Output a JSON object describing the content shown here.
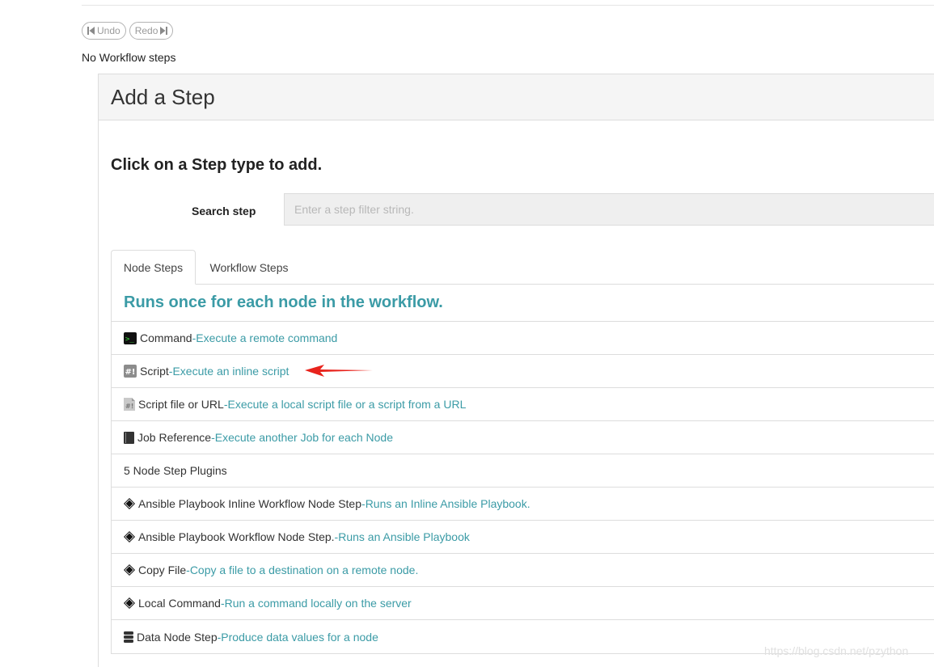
{
  "history": {
    "undo_label": "Undo",
    "redo_label": "Redo"
  },
  "workflow": {
    "empty_message": "No Workflow steps"
  },
  "panel": {
    "title": "Add a Step",
    "instruction": "Click on a Step type to add.",
    "search": {
      "label": "Search step",
      "placeholder": "Enter a step filter string.",
      "value": ""
    },
    "tabs": [
      {
        "label": "Node Steps",
        "active": true
      },
      {
        "label": "Workflow Steps",
        "active": false
      }
    ],
    "list_heading": "Runs once for each node in the workflow.",
    "steps": [
      {
        "icon": "terminal-icon",
        "name": "Command",
        "separator": " - ",
        "description": "Execute a remote command"
      },
      {
        "icon": "script-icon",
        "name": "Script",
        "separator": " - ",
        "description": "Execute an inline script"
      },
      {
        "icon": "script-file-icon",
        "name": "Script file or URL",
        "separator": " - ",
        "description": "Execute a local script file or a script from a URL"
      },
      {
        "icon": "book-icon",
        "name": "Job Reference",
        "separator": " - ",
        "description": "Execute another Job for each Node"
      }
    ],
    "plugins_heading": "5 Node Step Plugins",
    "plugins": [
      {
        "icon": "plugin-diamond-icon",
        "name": "Ansible Playbook Inline Workflow Node Step",
        "separator": " - ",
        "description": "Runs an Inline Ansible Playbook."
      },
      {
        "icon": "plugin-diamond-icon",
        "name": "Ansible Playbook Workflow Node Step.",
        "separator": " - ",
        "description": "Runs an Ansible Playbook"
      },
      {
        "icon": "plugin-diamond-icon",
        "name": "Copy File",
        "separator": " - ",
        "description": "Copy a file to a destination on a remote node."
      },
      {
        "icon": "plugin-diamond-icon",
        "name": "Local Command",
        "separator": " - ",
        "description": "Run a command locally on the server"
      },
      {
        "icon": "database-icon",
        "name": "Data Node Step",
        "separator": " - ",
        "description": "Produce data values for a node"
      }
    ]
  },
  "watermark": "https://blog.csdn.net/pzython",
  "colors": {
    "accent": "#3b9ba6",
    "annotation_arrow": "#e8231c"
  }
}
